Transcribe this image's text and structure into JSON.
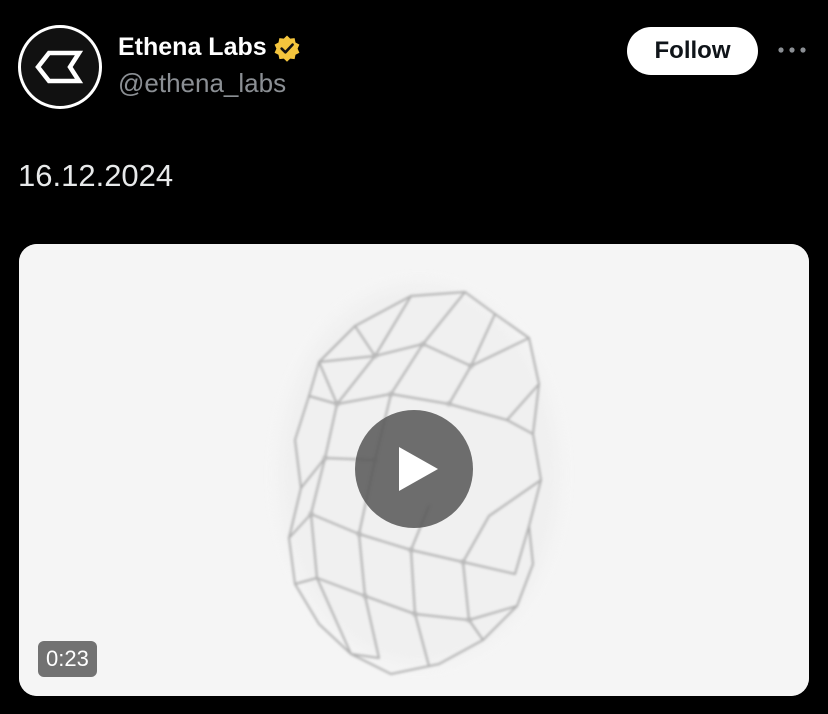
{
  "post": {
    "author": {
      "display_name": "Ethena Labs",
      "handle": "@ethena_labs",
      "verified": true,
      "verified_badge_color": "#F4C53D",
      "avatar_icon": "ethena-logo-icon"
    },
    "follow_label": "Follow",
    "more_icon": "more-options-icon",
    "text": "16.12.2024",
    "media": {
      "type": "video",
      "duration": "0:23",
      "play_icon": "play-icon",
      "background_color": "#F5F5F5"
    }
  },
  "colors": {
    "background": "#000000",
    "primary_text": "#E7E9EA",
    "secondary_text": "#8B8F94",
    "follow_button_bg": "#FFFFFF",
    "follow_button_text": "#0F1419"
  }
}
